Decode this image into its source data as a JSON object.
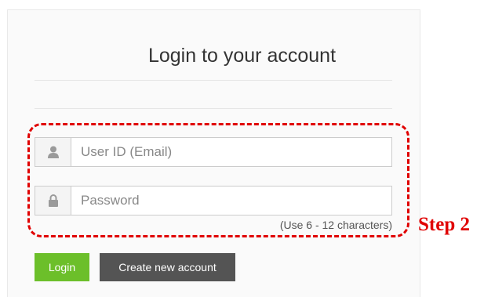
{
  "login_form": {
    "title": "Login to your account",
    "user_id": {
      "value": "",
      "placeholder": "User ID (Email)",
      "icon": "user-icon"
    },
    "password": {
      "value": "",
      "placeholder": "Password",
      "icon": "lock-icon",
      "hint": "(Use 6 - 12 characters)"
    },
    "login_label": "Login",
    "create_account_label": "Create new account"
  },
  "annotation": {
    "step_label": "Step 2",
    "color": "#e00000"
  },
  "colors": {
    "login_button": "#6cbf2a",
    "create_button": "#545454"
  }
}
